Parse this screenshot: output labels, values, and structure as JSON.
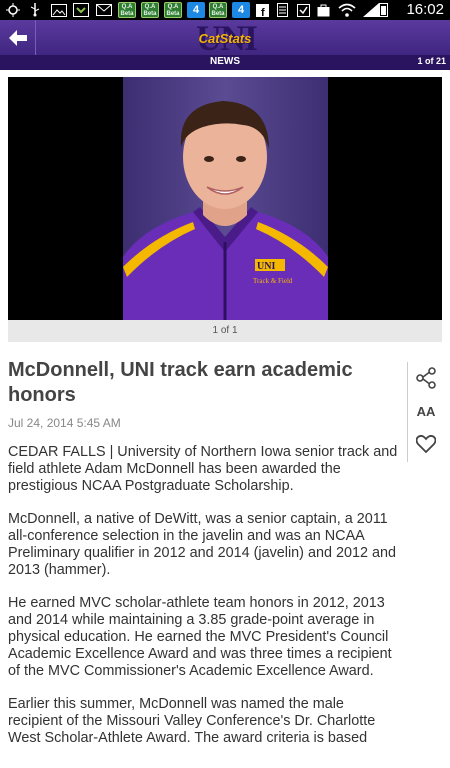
{
  "status_bar": {
    "time": "16:02",
    "apps": [
      "Q.A Beta",
      "Q.A Beta",
      "Q.A Beta",
      "Q.A Beta"
    ],
    "four_badge": "4"
  },
  "app_bar": {
    "logo_text": "UNI",
    "logo_subtext": "CatStats"
  },
  "sub_bar": {
    "section": "NEWS",
    "pager": "1 of 21"
  },
  "gallery": {
    "counter": "1 of 1",
    "jacket_logo": "UNI",
    "jacket_text": "Track & Field"
  },
  "article": {
    "headline": "McDonnell, UNI track earn academic honors",
    "date": "Jul 24, 2014 5:45 AM",
    "paragraphs": [
      "CEDAR FALLS | University of Northern Iowa senior track and field athlete Adam McDonnell has been awarded the prestigious NCAA Postgraduate Scholarship.",
      "McDonnell, a native of DeWitt, was a senior captain, a 2011 all-conference selection in the javelin and was an NCAA Preliminary qualifier in 2012 and 2014 (javelin) and 2012 and 2013 (hammer).",
      "He earned MVC scholar-athlete team honors in 2012, 2013 and 2014 while maintaining a 3.85 grade-point average in physical education. He earned the MVC President's Council Academic Excellence Award and was three times a recipient of the MVC Commissioner's Academic Excellence Award.",
      "Earlier this summer, McDonnell was named the male recipient of the Missouri Valley Conference's Dr. Charlotte West Scholar-Athlete Award. The award criteria is based"
    ]
  },
  "tools": {
    "font_size_label": "AA"
  },
  "colors": {
    "brand_purple": "#4b2e93",
    "brand_gold": "#f4b400",
    "status_bar": "#000000"
  }
}
